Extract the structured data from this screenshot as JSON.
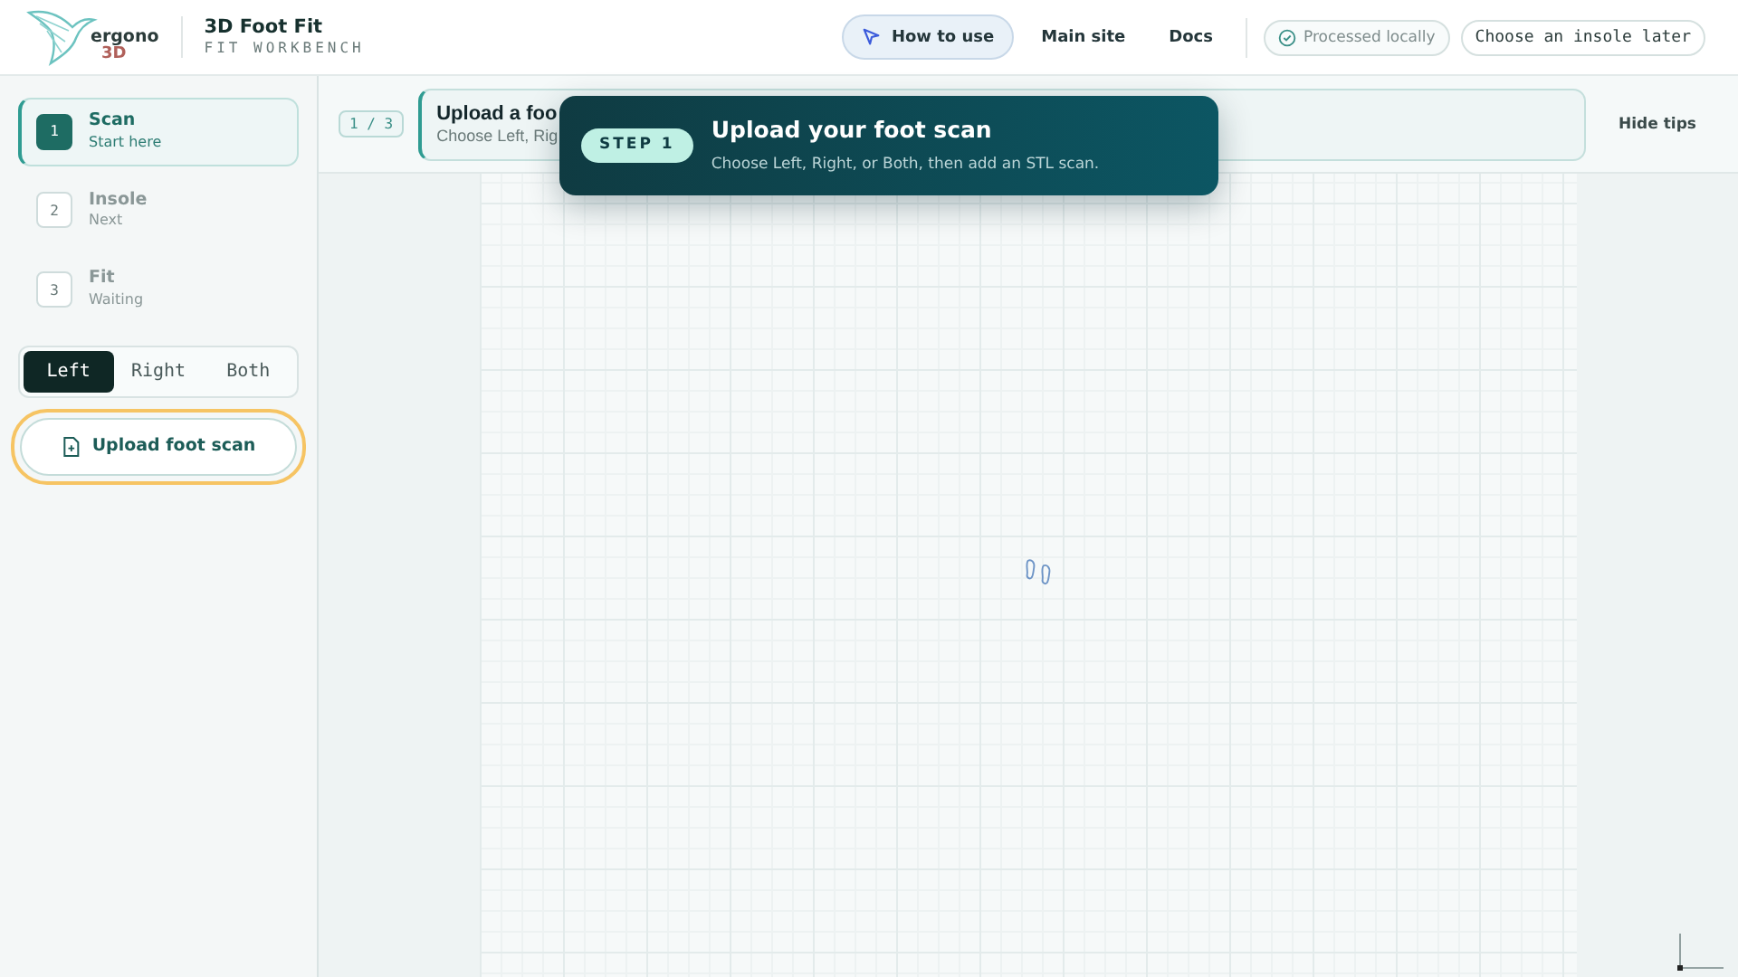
{
  "header": {
    "logo_text": "ergono",
    "logo_sub": "3D",
    "title": "3D Foot Fit",
    "subtitle": "FIT WORKBENCH",
    "nav": [
      {
        "label": "How to use",
        "selected": true
      },
      {
        "label": "Main site",
        "selected": false
      },
      {
        "label": "Docs",
        "selected": false
      }
    ],
    "badge": "Processed locally",
    "insole_button": "Choose an insole later"
  },
  "steps": [
    {
      "number": "1",
      "title": "Scan",
      "status": "Start here",
      "selected": true
    },
    {
      "number": "2",
      "title": "Insole",
      "status": "Next",
      "selected": false
    },
    {
      "number": "3",
      "title": "Fit",
      "status": "Waiting",
      "selected": false
    }
  ],
  "sides": [
    {
      "label": "Left",
      "selected": true
    },
    {
      "label": "Right",
      "selected": false
    },
    {
      "label": "Both",
      "selected": false
    }
  ],
  "upload_button": {
    "label": "Upload foot scan",
    "highlighted": true
  },
  "tips": {
    "counter": "1 / 3",
    "title": "Upload a foo",
    "text": "Choose Left, Rig",
    "hide": "Hide tips"
  },
  "tooltip": {
    "step": "STEP 1",
    "title": "Upload your foot scan",
    "text": "Choose Left, Right, or Both, then add an STL scan."
  }
}
